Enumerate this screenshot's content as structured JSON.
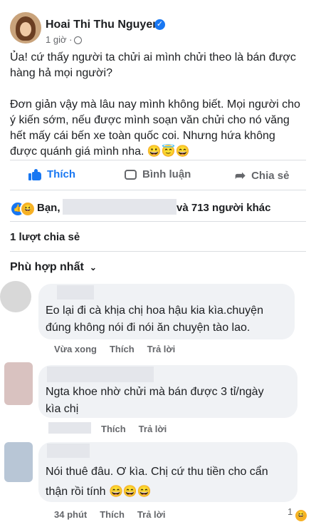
{
  "post": {
    "author": "Hoai Thi Thu Nguyen",
    "time": "1 giờ ·",
    "paragraphs": [
      "Ủa!  cứ thấy người ta chửi ai mình chửi theo là bán được hàng hả mọi người?",
      "Đơn giản vậy mà lâu nay mình không biết. Mọi người cho ý kiến sớm, nếu được mình soạn văn chửi cho nó văng hết mấy cái bến xe toàn quốc coi. Nhưng hứa không được quánh giá mình nha. 😀😇😄"
    ]
  },
  "actions": {
    "like": "Thích",
    "comment": "Bình luận",
    "share": "Chia sẻ"
  },
  "reactions": {
    "prefix": "Bạn,",
    "suffix": "và 713 người khác"
  },
  "shares": "1 lượt chia sẻ",
  "sort_label": "Phù hợp nhất",
  "comments": [
    {
      "text": "Eo lại đi cà khịa chị hoa hậu kia kìa.chuyện đúng không nói đi nói ăn chuyện tào lao.",
      "time": "Vừa xong",
      "like": "Thích",
      "reply": "Trả lời"
    },
    {
      "text": "Ngta khoe nhờ chửi mà bán được 3 tỉ/ngày kìa chị",
      "like": "Thích",
      "reply": "Trả lời"
    },
    {
      "text": "Nói thuê đâu. Ơ kìa. Chị cứ thu tiền cho cẩn thận rồi tính 😄😄😄",
      "time": "34 phút",
      "like": "Thích",
      "reply": "Trả lời",
      "reaction_count": "1"
    }
  ]
}
